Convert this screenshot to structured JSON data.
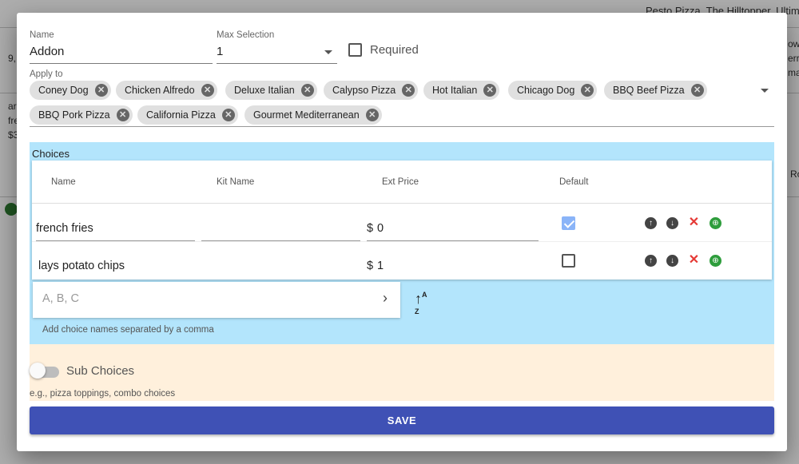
{
  "background": {
    "top_right_text": "Pesto Pizza, The Hilltopper, Ultimat",
    "left_fragments": [
      "9,",
      "ar",
      "fre",
      "$3"
    ],
    "right_fragments": [
      "own",
      "err",
      "mat",
      "Ro"
    ]
  },
  "form": {
    "name_label": "Name",
    "name_value": "Addon",
    "max_selection_label": "Max Selection",
    "max_selection_value": "1",
    "required_label": "Required",
    "required_checked": false,
    "apply_to_label": "Apply to",
    "apply_to_chips": [
      "Coney Dog",
      "Chicken Alfredo",
      "Deluxe Italian",
      "Calypso Pizza",
      "Hot Italian",
      "Chicago Dog",
      "BBQ Beef Pizza",
      "BBQ Pork Pizza",
      "California Pizza",
      "Gourmet Mediterranean"
    ]
  },
  "choices": {
    "title": "Choices",
    "headers": {
      "name": "Name",
      "kit_name": "Kit Name",
      "ext_price": "Ext Price",
      "default": "Default"
    },
    "rows": [
      {
        "name": "french fries",
        "kit_name": "",
        "price_prefix": "$",
        "price": "0",
        "default": true
      },
      {
        "name": "lays potato chips",
        "kit_name": "",
        "price_prefix": "$",
        "price": "1",
        "default": false
      }
    ],
    "add_placeholder": "A, B, C",
    "add_helper": "Add choice names separated by a comma"
  },
  "sub_choices": {
    "label": "Sub Choices",
    "enabled": false,
    "helper": "e.g., pizza toppings, combo choices"
  },
  "save_label": "SAVE",
  "colors": {
    "choices_bg": "#b3e5fc",
    "sub_choices_bg": "#fff0dc",
    "save_button": "#3f51b5",
    "delete": "#e53935",
    "web": "#2e9d3c",
    "checked": "#8ab4f8"
  }
}
